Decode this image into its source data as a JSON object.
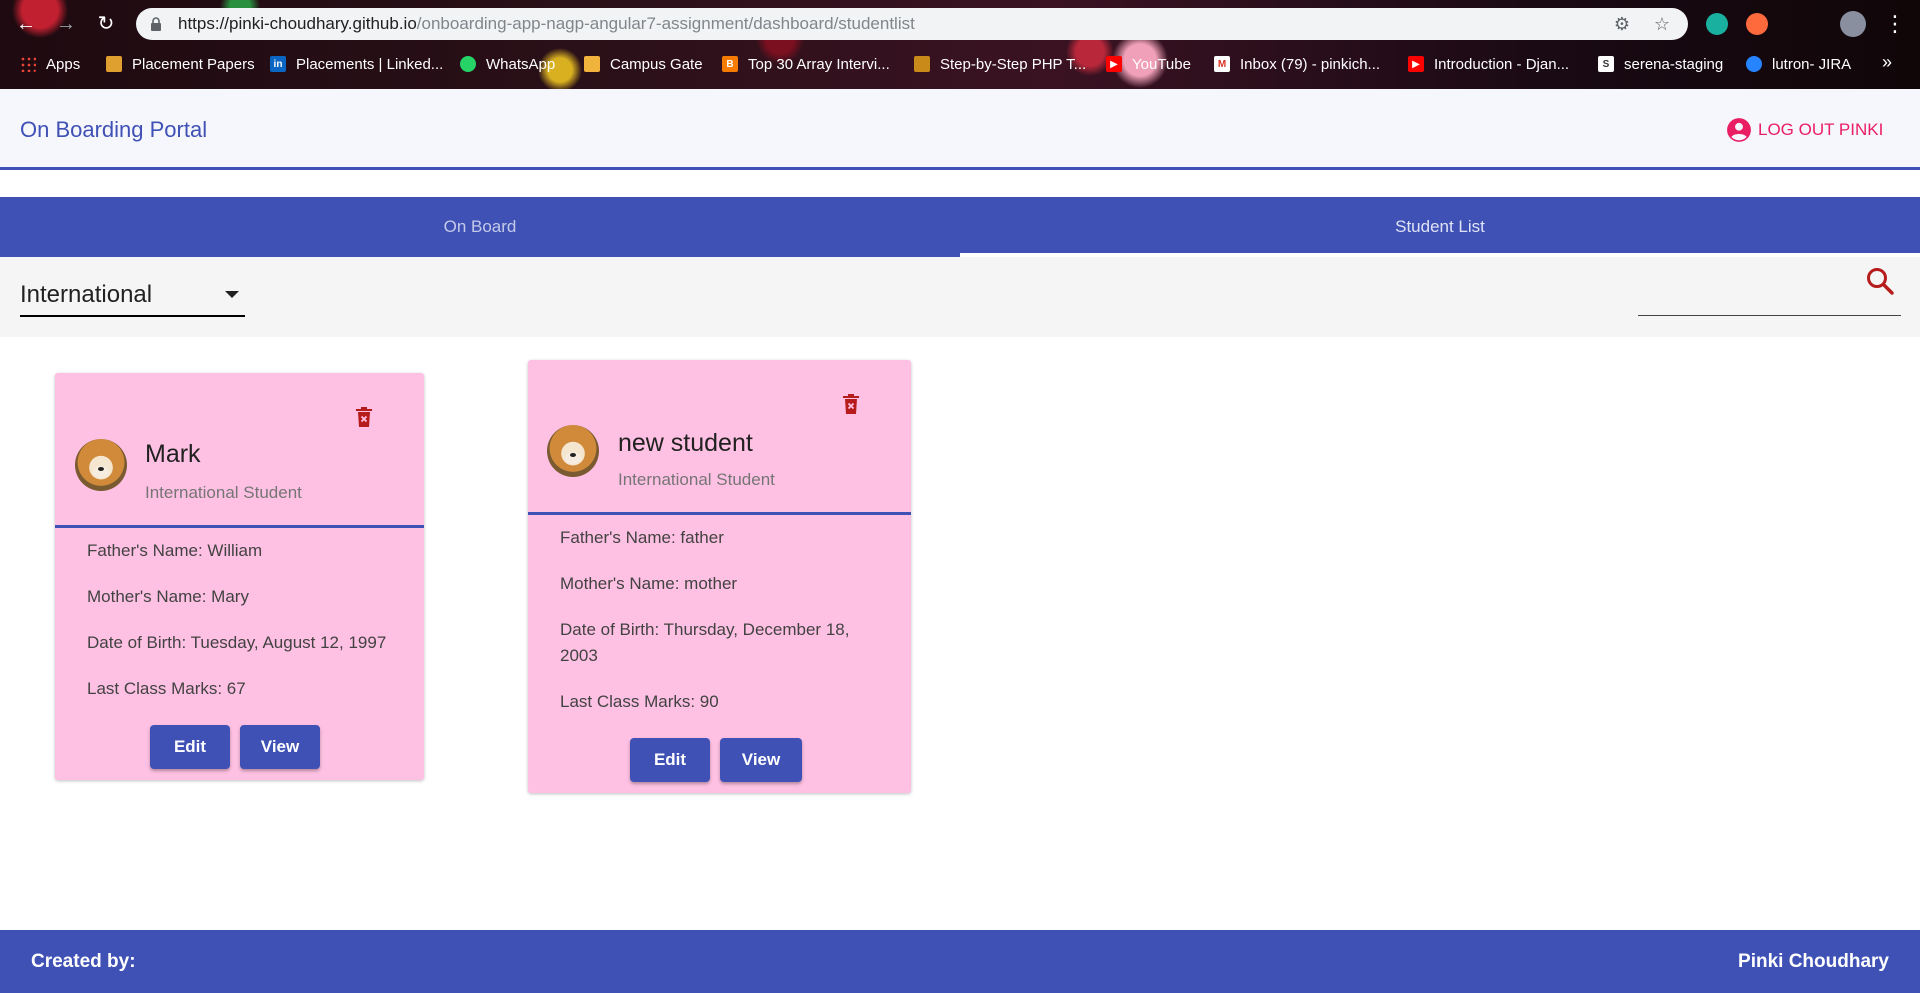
{
  "browser": {
    "url_host": "https://pinki-choudhary.github.io",
    "url_path": "/onboarding-app-nagp-angular7-assignment/dashboard/studentlist",
    "bookmarks": [
      {
        "label": "Apps",
        "color": "#ea4335"
      },
      {
        "label": "Placement Papers",
        "color": "#e0a030"
      },
      {
        "label": "Placements | Linked...",
        "color": "#0a66c2"
      },
      {
        "label": "WhatsApp",
        "color": "#25d366"
      },
      {
        "label": "Campus Gate",
        "color": "#f2b33d"
      },
      {
        "label": "Top 30 Array Intervi...",
        "color": "#f57c00"
      },
      {
        "label": "Step-by-Step PHP T...",
        "color": "#c98a1a"
      },
      {
        "label": "YouTube",
        "color": "#ff0000"
      },
      {
        "label": "Inbox (79) - pinkich...",
        "color": "#d93025"
      },
      {
        "label": "Introduction - Djan...",
        "color": "#ff0000"
      },
      {
        "label": "serena-staging",
        "color": "#ffffff"
      },
      {
        "label": "lutron- JIRA",
        "color": "#2684ff"
      }
    ]
  },
  "header": {
    "title": "On Boarding Portal",
    "logout_label": "LOG OUT PINKI",
    "accent": "#3f51b5",
    "logout_color": "#e91e63"
  },
  "tabs": [
    {
      "label": "On Board",
      "active": false
    },
    {
      "label": "Student List",
      "active": true
    }
  ],
  "filter": {
    "selected": "International",
    "search_value": ""
  },
  "students": [
    {
      "name": "Mark",
      "category": "International Student",
      "father": "Father's Name: William",
      "mother": "Mother's Name: Mary",
      "dob": "Date of Birth: Tuesday, August 12, 1997",
      "marks": "Last Class Marks: 67",
      "edit_label": "Edit",
      "view_label": "View"
    },
    {
      "name": "new student",
      "category": "International Student",
      "father": "Father's Name: father",
      "mother": "Mother's Name: mother",
      "dob": "Date of Birth: Thursday, December 18, 2003",
      "marks": "Last Class Marks: 90",
      "edit_label": "Edit",
      "view_label": "View"
    }
  ],
  "footer": {
    "left": "Created by:",
    "right": "Pinki Choudhary"
  },
  "colors": {
    "card_bg": "#ffc1e3",
    "delete_icon": "#b71c1c",
    "primary": "#3f51b5"
  }
}
